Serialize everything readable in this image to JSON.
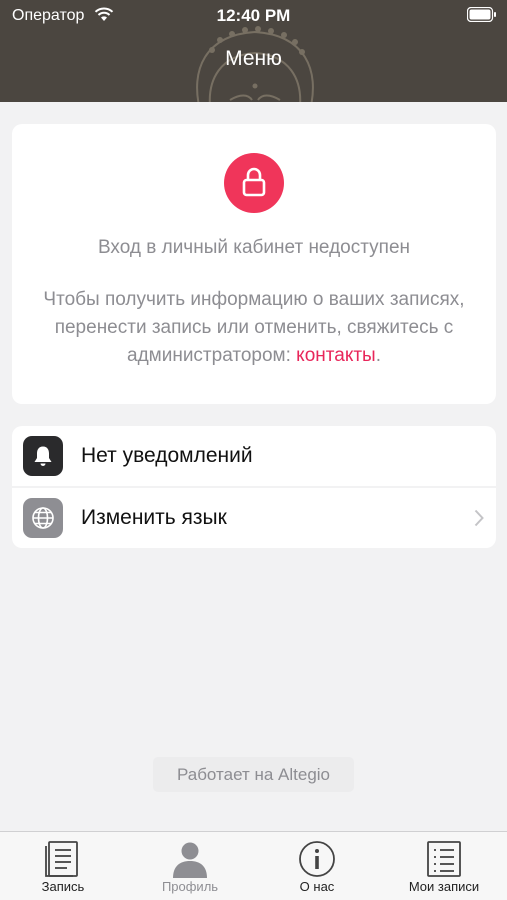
{
  "status_bar": {
    "carrier": "Оператор",
    "time": "12:40 PM"
  },
  "header": {
    "title": "Меню"
  },
  "login_card": {
    "heading": "Вход в личный кабинет недоступен",
    "text": "Чтобы получить информацию о ваших записях, перенести запись или отменить, свяжитесь с администратором:",
    "link": "контакты",
    "text_end": "."
  },
  "menu": {
    "items": [
      {
        "label": "Нет уведомлений",
        "icon": "bell-icon"
      },
      {
        "label": "Изменить язык",
        "icon": "globe-icon"
      }
    ]
  },
  "footer": {
    "powered_by": "Работает на Altegio"
  },
  "tabbar": {
    "tabs": [
      {
        "label": "Запись",
        "icon": "document-icon",
        "active": false
      },
      {
        "label": "Профиль",
        "icon": "profile-icon",
        "active": true
      },
      {
        "label": "О нас",
        "icon": "info-icon",
        "active": false
      },
      {
        "label": "Мои записи",
        "icon": "list-icon",
        "active": false
      }
    ]
  },
  "colors": {
    "header_bg": "#4b4640",
    "accent": "#f0355a",
    "link": "#e8265a",
    "muted_text": "#8d8d92"
  }
}
